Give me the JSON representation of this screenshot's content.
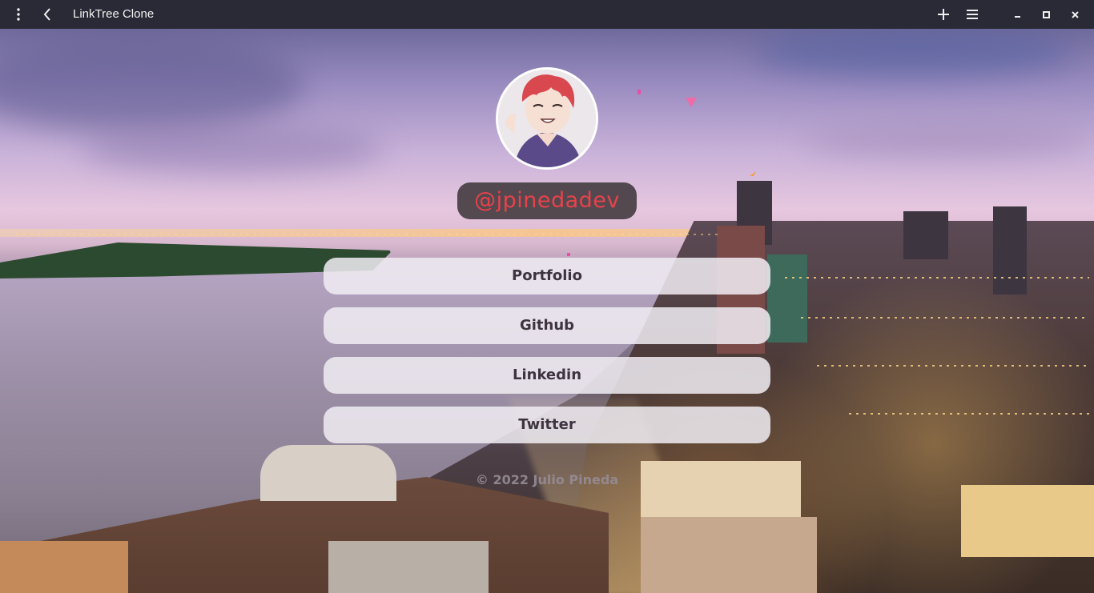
{
  "window": {
    "title": "LinkTree Clone",
    "menu_icon": "kebab-menu-icon",
    "back_icon": "chevron-left-icon",
    "new_tab_icon": "plus-icon",
    "options_icon": "hamburger-icon",
    "minimize_icon": "minimize-icon",
    "maximize_icon": "maximize-icon",
    "close_icon": "close-icon"
  },
  "profile": {
    "username": "@jpinedadev",
    "avatar": "anime-avatar"
  },
  "links": [
    {
      "label": "Portfolio"
    },
    {
      "label": "Github"
    },
    {
      "label": "Linkedin"
    },
    {
      "label": "Twitter"
    }
  ],
  "footer": {
    "copyright": "© 2022 Julio Pineda"
  },
  "colors": {
    "titlebar_bg": "#292a35",
    "username_text": "#e8424b",
    "username_bg": "#463e42",
    "button_bg": "#f0ecf2",
    "button_text": "#3d3440"
  }
}
